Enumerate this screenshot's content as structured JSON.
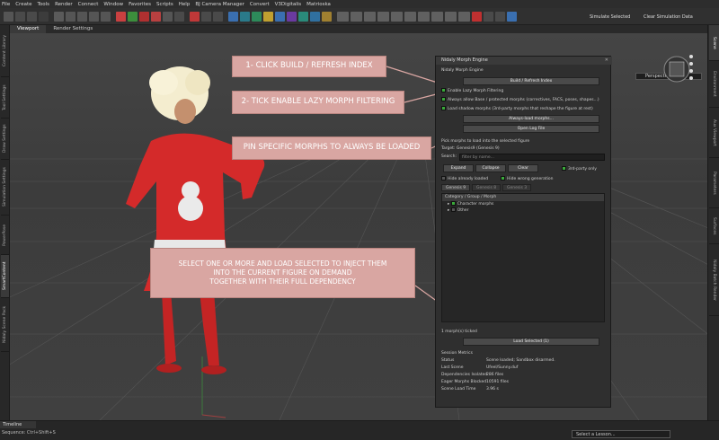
{
  "menu": [
    "File",
    "Create",
    "Tools",
    "Render",
    "Connect",
    "Window",
    "Favorites",
    "Scripts",
    "Help",
    "BJ Camera Manager",
    "Convert",
    "V3Digitalis",
    "Matrioska"
  ],
  "toolbar": {
    "simulate_label": "Simulate Selected",
    "clear_sim_label": "Clear Simulation Data"
  },
  "viewport": {
    "tabs": [
      "Viewport",
      "Render Settings"
    ],
    "view_mode": "Perspective View"
  },
  "left_tabs": [
    "Content Library",
    "Tool Settings",
    "Draw Settings",
    "Simulation Settings",
    "PowerPose",
    "SmartContent",
    "Nidaly Scene Pack"
  ],
  "right_tabs": [
    "Scene",
    "Environment",
    "Aux Viewport",
    "Parameters",
    "Surfaces",
    "Nidaly Batch Render"
  ],
  "callouts": {
    "step1": "1- CLICK BUILD / REFRESH INDEX",
    "step2": "2- TICK ENABLE LAZY MORPH FILTERING",
    "step3": "PIN SPECIFIC MORPHS TO ALWAYS BE LOADED",
    "step4_line1": "SELECT ONE OR MORE AND LOAD SELECTED TO INJECT THEM",
    "step4_line2": "INTO THE CURRENT FIGURE ON DEMAND",
    "step4_line3": "TOGETHER WITH THEIR FULL DEPENDENCY"
  },
  "panel": {
    "title": "Nidaly Morph Engine",
    "subtitle": "Nidaly Morph Engine",
    "build_btn": "Build / Refresh Index",
    "opt_enable_lazy": "Enable Lazy Morph Filtering",
    "opt_always_allow": "Always allow Base / protected morphs (correctives, FACS, poses, shapes...)",
    "opt_load_shadow": "Load shadow morphs (3rd-party morphs that reshape the figure at rest)",
    "always_load_btn": "Always-load morphs...",
    "open_log_btn": "Open Log File",
    "pick_label": "Pick morphs to load into the selected figure",
    "target_label": "Target: Genesis9 (Genesis 9)",
    "search_label": "Search:",
    "search_placeholder": "filter by name...",
    "expand_btn": "Expand",
    "collapse_btn": "Collapse",
    "clear_btn": "Clear",
    "third_party_label": "3rd-party only",
    "hide_loaded_label": "Hide already loaded",
    "hide_wrong_label": "Hide wrong generation",
    "gen_tabs": [
      "Genesis 9",
      "Genesis 8",
      "Genesis 3"
    ],
    "tree_header": "Category / Group / Morph",
    "tree_items": [
      "Character morphs",
      "Other"
    ],
    "ticked_count": "1 morph(s) ticked",
    "load_selected_btn": "Load Selected (1)",
    "metrics_title": "Session Metrics",
    "metrics": [
      {
        "k": "Status",
        "v": "Scene loaded; Sandbox disarmed."
      },
      {
        "k": "Last Scene",
        "v": "Ufeel/Sunny.duf"
      },
      {
        "k": "Dependencies Isolated",
        "v": "286 files"
      },
      {
        "k": "Eager Morphs Blocked",
        "v": "10591 files"
      },
      {
        "k": "Scene Load Time",
        "v": "3.96 s"
      }
    ]
  },
  "status": {
    "timeline": "Timeline",
    "hint": "Sequence: Ctrl+Shift+S",
    "lesson": "Select a Lesson..."
  },
  "colors": {
    "callout": "#d9a6a2",
    "checkbox": "#3aaa3a",
    "dress": "#d42a2a"
  }
}
